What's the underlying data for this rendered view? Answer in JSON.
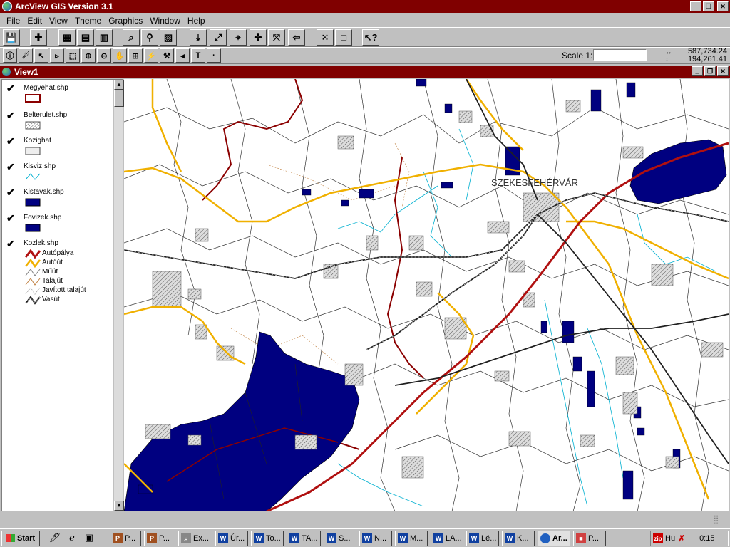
{
  "app": {
    "title": "ArcView GIS Version 3.1"
  },
  "menu": [
    "File",
    "Edit",
    "View",
    "Theme",
    "Graphics",
    "Window",
    "Help"
  ],
  "toolbar": {
    "scale_label": "Scale 1:",
    "scale_value": "",
    "coord_x": "587,734.24",
    "coord_y": "194,261.41"
  },
  "view": {
    "title": "View1"
  },
  "legend": [
    {
      "name": "Megyehat.shp",
      "checked": true,
      "symbol": "outline-red"
    },
    {
      "name": "Belterulet.shp",
      "checked": true,
      "symbol": "hatched"
    },
    {
      "name": "Kozighat",
      "checked": true,
      "symbol": "outline-grey"
    },
    {
      "name": "Kisviz.shp",
      "checked": true,
      "symbol": "line-cyan"
    },
    {
      "name": "Kistavak.shp",
      "checked": true,
      "symbol": "fill-navy"
    },
    {
      "name": "Fovizek.shp",
      "checked": true,
      "symbol": "fill-navy"
    },
    {
      "name": "Kozlek.shp",
      "checked": true,
      "symbol": "classes"
    }
  ],
  "road_classes": [
    {
      "label": "Autópálya",
      "color": "#b01010"
    },
    {
      "label": "Autóút",
      "color": "#f0b000"
    },
    {
      "label": "Műút",
      "color": "#808080"
    },
    {
      "label": "Talajút",
      "color": "#c08040"
    },
    {
      "label": "Javított talajút",
      "color": "#a0a0a0"
    },
    {
      "label": "Vasút",
      "color": "#202020"
    }
  ],
  "map": {
    "city_label": "SZEKESFEHÉRVÁR"
  },
  "taskbar": {
    "start": "Start",
    "tasks": [
      "P...",
      "P...",
      "Ex...",
      "Úr...",
      "To...",
      "TA...",
      "S...",
      "N...",
      "M...",
      "LA...",
      "Lé...",
      "K...",
      "Ar...",
      "P..."
    ],
    "tray_lang": "Hu",
    "clock": "0:15"
  },
  "colors": {
    "title": "#800000",
    "lake": "#000080",
    "boundary": "#8b0000",
    "highway": "#b01010",
    "road": "#f0b000",
    "stream": "#00b0d0"
  }
}
